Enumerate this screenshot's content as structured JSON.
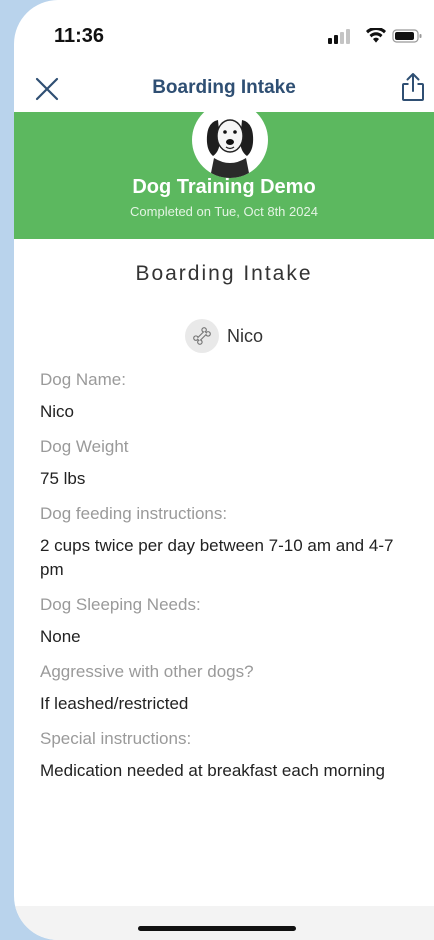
{
  "status_bar": {
    "time": "11:36"
  },
  "nav": {
    "title": "Boarding Intake"
  },
  "banner": {
    "org_name": "Dog Training Demo",
    "completed": "Completed on Tue, Oct 8th 2024",
    "color": "#5cb85f"
  },
  "form": {
    "title": "Boarding Intake",
    "pet_name": "Nico",
    "fields": [
      {
        "label": "Dog Name:",
        "value": "Nico"
      },
      {
        "label": "Dog Weight",
        "value": "75 lbs"
      },
      {
        "label": "Dog feeding instructions:",
        "value": "2 cups twice per day between 7-10 am and 4-7 pm"
      },
      {
        "label": "Dog Sleeping Needs:",
        "value": "None"
      },
      {
        "label": "Aggressive with other dogs?",
        "value": "If leashed/restricted"
      },
      {
        "label": "Special instructions:",
        "value": "Medication needed at breakfast each morning"
      }
    ]
  },
  "icons": {
    "close": "close-icon",
    "share": "share-icon",
    "pet": "bone-icon"
  }
}
